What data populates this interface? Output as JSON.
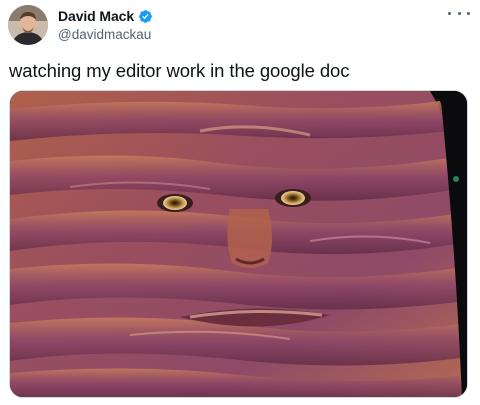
{
  "tweet": {
    "author": {
      "display_name": "David Mack",
      "handle": "@davidmackau",
      "verified": true,
      "avatar_icon": "person-avatar",
      "verified_color": "#1d9bf0"
    },
    "more_icon": "ellipsis-icon",
    "text": "watching my editor work in the google doc",
    "media": {
      "type": "image",
      "subject": "melting-face-meme"
    }
  },
  "colors": {
    "text_primary": "#0f1419",
    "text_secondary": "#536471",
    "border": "#cfd9de"
  }
}
